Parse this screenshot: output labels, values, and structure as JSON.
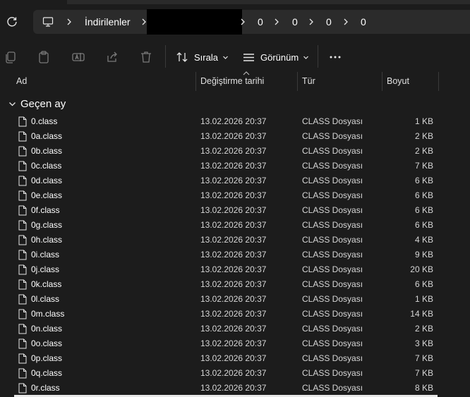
{
  "address": {
    "crumbs": [
      "İndirilenler",
      "0",
      "0",
      "0",
      "0"
    ]
  },
  "toolbar": {
    "sort_label": "Sırala",
    "view_label": "Görünüm"
  },
  "columns": {
    "name": "Ad",
    "modified": "Değiştirme tarihi",
    "type": "Tür",
    "size": "Boyut"
  },
  "group": {
    "label": "Geçen ay"
  },
  "files": [
    {
      "name": "0.class",
      "modified": "13.02.2026 20:37",
      "type": "CLASS Dosyası",
      "size": "1 KB"
    },
    {
      "name": "0a.class",
      "modified": "13.02.2026 20:37",
      "type": "CLASS Dosyası",
      "size": "2 KB"
    },
    {
      "name": "0b.class",
      "modified": "13.02.2026 20:37",
      "type": "CLASS Dosyası",
      "size": "2 KB"
    },
    {
      "name": "0c.class",
      "modified": "13.02.2026 20:37",
      "type": "CLASS Dosyası",
      "size": "7 KB"
    },
    {
      "name": "0d.class",
      "modified": "13.02.2026 20:37",
      "type": "CLASS Dosyası",
      "size": "6 KB"
    },
    {
      "name": "0e.class",
      "modified": "13.02.2026 20:37",
      "type": "CLASS Dosyası",
      "size": "6 KB"
    },
    {
      "name": "0f.class",
      "modified": "13.02.2026 20:37",
      "type": "CLASS Dosyası",
      "size": "6 KB"
    },
    {
      "name": "0g.class",
      "modified": "13.02.2026 20:37",
      "type": "CLASS Dosyası",
      "size": "6 KB"
    },
    {
      "name": "0h.class",
      "modified": "13.02.2026 20:37",
      "type": "CLASS Dosyası",
      "size": "4 KB"
    },
    {
      "name": "0i.class",
      "modified": "13.02.2026 20:37",
      "type": "CLASS Dosyası",
      "size": "9 KB"
    },
    {
      "name": "0j.class",
      "modified": "13.02.2026 20:37",
      "type": "CLASS Dosyası",
      "size": "20 KB"
    },
    {
      "name": "0k.class",
      "modified": "13.02.2026 20:37",
      "type": "CLASS Dosyası",
      "size": "6 KB"
    },
    {
      "name": "0l.class",
      "modified": "13.02.2026 20:37",
      "type": "CLASS Dosyası",
      "size": "1 KB"
    },
    {
      "name": "0m.class",
      "modified": "13.02.2026 20:37",
      "type": "CLASS Dosyası",
      "size": "14 KB"
    },
    {
      "name": "0n.class",
      "modified": "13.02.2026 20:37",
      "type": "CLASS Dosyası",
      "size": "2 KB"
    },
    {
      "name": "0o.class",
      "modified": "13.02.2026 20:37",
      "type": "CLASS Dosyası",
      "size": "3 KB"
    },
    {
      "name": "0p.class",
      "modified": "13.02.2026 20:37",
      "type": "CLASS Dosyası",
      "size": "7 KB"
    },
    {
      "name": "0q.class",
      "modified": "13.02.2026 20:37",
      "type": "CLASS Dosyası",
      "size": "7 KB"
    },
    {
      "name": "0r.class",
      "modified": "13.02.2026 20:37",
      "type": "CLASS Dosyası",
      "size": "8 KB"
    }
  ],
  "colors": {
    "background": "#1c1c1c",
    "address_bar": "#2b2b2b",
    "text": "#ffffff",
    "muted_icon": "#7a7a7a"
  }
}
